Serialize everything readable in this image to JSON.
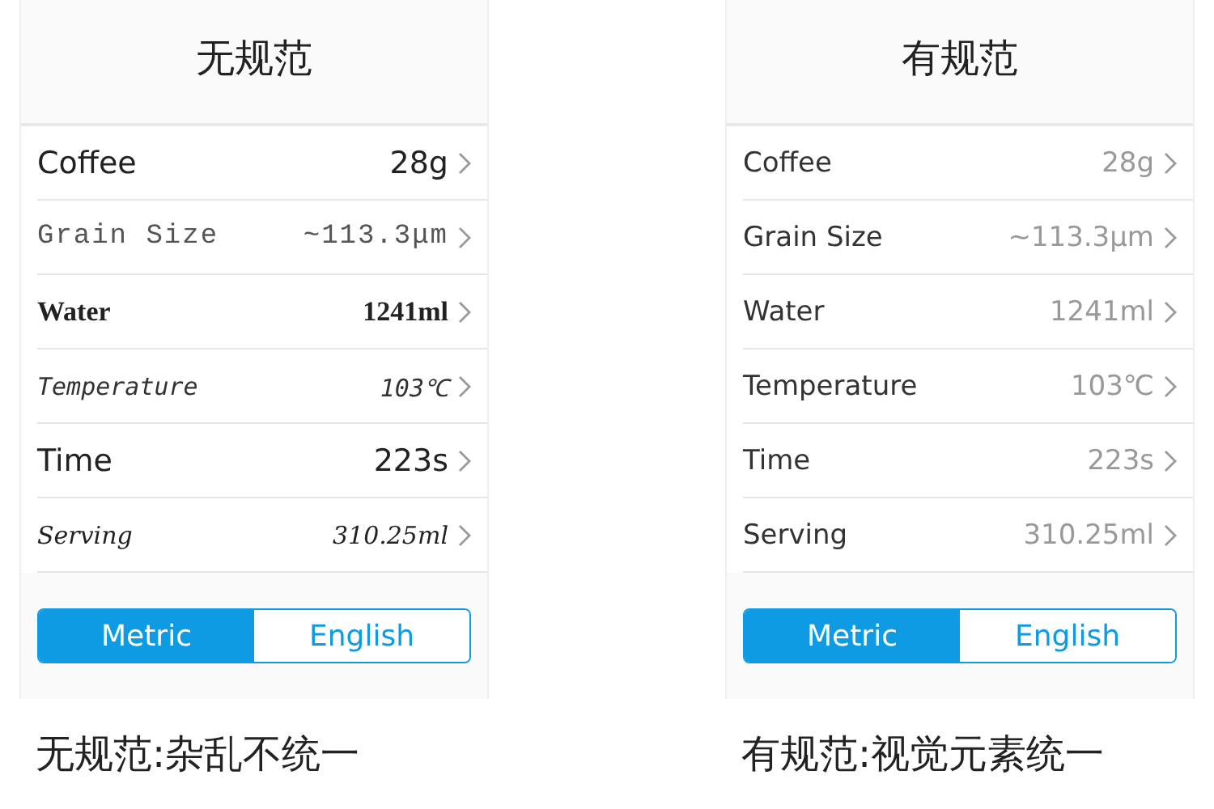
{
  "panels": [
    {
      "title": "无规范",
      "rows": [
        {
          "label": "Coffee",
          "value": "28g",
          "kind": "sans"
        },
        {
          "label": "Grain Size",
          "value": "~113.3μm",
          "kind": "mono"
        },
        {
          "label": "Water",
          "value": "1241ml",
          "kind": "serif"
        },
        {
          "label": "Temperature",
          "value": "103℃",
          "kind": "hand"
        },
        {
          "label": "Time",
          "value": "223s",
          "kind": "sans"
        },
        {
          "label": "Serving",
          "value": "310.25ml",
          "kind": "script"
        }
      ],
      "units": [
        {
          "label": "Metric",
          "selected": true
        },
        {
          "label": "English",
          "selected": false
        }
      ],
      "caption": "无规范:杂乱不统一"
    },
    {
      "title": "有规范",
      "rows": [
        {
          "label": "Coffee",
          "value": "28g",
          "kind": "plain"
        },
        {
          "label": "Grain Size",
          "value": "~113.3μm",
          "kind": "plain"
        },
        {
          "label": "Water",
          "value": "1241ml",
          "kind": "plain"
        },
        {
          "label": "Temperature",
          "value": "103℃",
          "kind": "plain"
        },
        {
          "label": "Time",
          "value": "223s",
          "kind": "plain"
        },
        {
          "label": "Serving",
          "value": "310.25ml",
          "kind": "plain"
        }
      ],
      "units": [
        {
          "label": "Metric",
          "selected": true
        },
        {
          "label": "English",
          "selected": false
        }
      ],
      "caption": "有规范:视觉元素统一"
    }
  ]
}
